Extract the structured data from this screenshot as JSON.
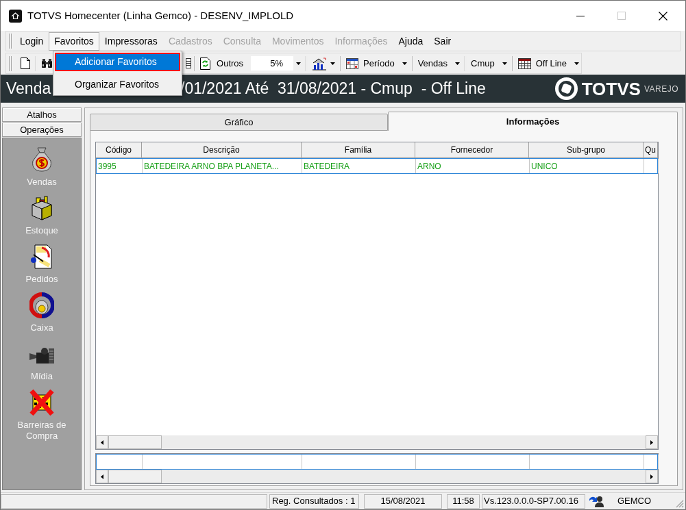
{
  "window": {
    "title": "TOTVS Homecenter (Linha Gemco) - DESENV_IMPLOLD"
  },
  "menu_bar": [
    {
      "label": "Login",
      "disabled": false,
      "open": false
    },
    {
      "label": "Favoritos",
      "disabled": false,
      "open": true
    },
    {
      "label": "Impressoras",
      "disabled": false,
      "open": false
    },
    {
      "label": "Cadastros",
      "disabled": true,
      "open": false
    },
    {
      "label": "Consulta",
      "disabled": true,
      "open": false
    },
    {
      "label": "Movimentos",
      "disabled": true,
      "open": false
    },
    {
      "label": "Informações",
      "disabled": true,
      "open": false
    },
    {
      "label": "Ajuda",
      "disabled": false,
      "open": false
    },
    {
      "label": "Sair",
      "disabled": false,
      "open": false
    }
  ],
  "favoritos_menu": [
    {
      "label": "Adicionar Favoritos",
      "selected": true,
      "outlined": true
    },
    {
      "label": "Organizar Favoritos",
      "selected": false,
      "outlined": false
    }
  ],
  "toolbar": {
    "refresh_label": "Outros",
    "percent_combo": {
      "value": "5%"
    },
    "dropdowns": [
      {
        "label": "Período"
      },
      {
        "label": "Vendas"
      },
      {
        "label": "Cmup"
      },
      {
        "label": "Off Line"
      }
    ]
  },
  "banner": {
    "title_start": "Venda",
    "title_end": "/01/2021 Até  31/08/2021 - Cmup  - Off Line",
    "brand": "TOTVS",
    "brand_sub": "VAREJO"
  },
  "sidebar": {
    "sections": [
      {
        "label": "Atalhos"
      },
      {
        "label": "Operações"
      }
    ],
    "items": [
      {
        "label": "Vendas"
      },
      {
        "label": "Estoque"
      },
      {
        "label": "Pedidos"
      },
      {
        "label": "Caixa"
      },
      {
        "label": "Mídia"
      },
      {
        "label": "Barreiras de Compra"
      }
    ]
  },
  "tabs": [
    {
      "label": "Gráfico",
      "selected": false
    },
    {
      "label": "Informações",
      "selected": true
    }
  ],
  "table": {
    "columns": [
      "Código",
      "Descrição",
      "Família",
      "Fornecedor",
      "Sub-grupo",
      "Qu"
    ],
    "rows": [
      {
        "cells": [
          "3995",
          "BATEDEIRA ARNO BPA PLANETA...",
          "BATEDEIRA",
          "ARNO",
          "UNICO"
        ],
        "selected": true
      }
    ]
  },
  "status_bar": {
    "records": "Reg. Consultados : 1",
    "date": "15/08/2021",
    "time": "11:58",
    "version": "Vs.123.0.0.0-SP7.00.16",
    "user": "GEMCO"
  }
}
